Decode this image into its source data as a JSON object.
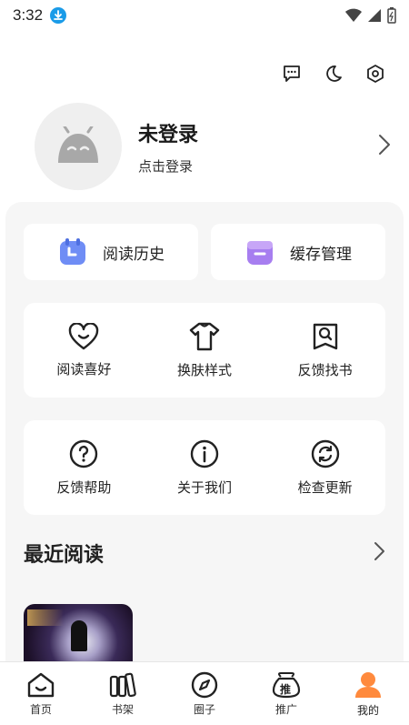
{
  "status": {
    "time": "3:32"
  },
  "profile": {
    "name": "未登录",
    "subtitle": "点击登录"
  },
  "quick": [
    {
      "label": "阅读历史",
      "color": "#6f8df5"
    },
    {
      "label": "缓存管理",
      "color": "#a77ef0"
    }
  ],
  "grid1": [
    {
      "label": "阅读喜好"
    },
    {
      "label": "换肤样式"
    },
    {
      "label": "反馈找书"
    }
  ],
  "grid2": [
    {
      "label": "反馈帮助"
    },
    {
      "label": "关于我们"
    },
    {
      "label": "检查更新"
    }
  ],
  "recent": {
    "title": "最近阅读"
  },
  "nav": [
    {
      "label": "首页"
    },
    {
      "label": "书架"
    },
    {
      "label": "圈子"
    },
    {
      "label": "推广",
      "badge": "推"
    },
    {
      "label": "我的",
      "active_color": "#ff8a3d"
    }
  ]
}
